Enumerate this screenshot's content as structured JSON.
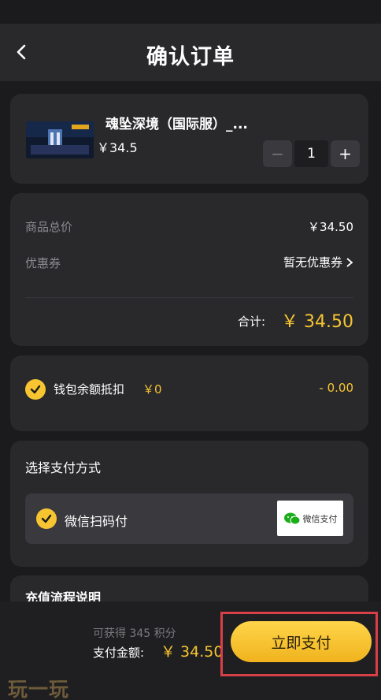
{
  "header": {
    "title": "确认订单"
  },
  "product": {
    "name": "魂坠深境（国际服）_...",
    "price": "￥34.5",
    "quantity": "1",
    "minus_label": "−",
    "plus_label": "+"
  },
  "summary": {
    "subtotal_label": "商品总价",
    "subtotal_value": "￥34.50",
    "coupon_label": "优惠券",
    "coupon_value": "暂无优惠券",
    "total_label": "合计:",
    "total_value": "￥ 34.50"
  },
  "wallet": {
    "label": "钱包余额抵扣",
    "amount": "￥0",
    "deduction": "- 0.00",
    "checked": true
  },
  "payment": {
    "title": "选择支付方式",
    "option_label": "微信扫码付",
    "option_checked": true,
    "badge_text": "微信支付"
  },
  "guide": {
    "title": "充值流程说明"
  },
  "footer": {
    "points": "可获得 345 积分",
    "pay_amount_label": "支付金额:",
    "pay_amount_value": "￥ 34.50",
    "pay_button": "立即支付"
  },
  "watermark": "玩一玩",
  "colors": {
    "accent": "#f7c531",
    "background": "#1b1b1d",
    "card": "#29292c",
    "highlight": "#d83f47",
    "wechat_green": "#1aad19"
  }
}
